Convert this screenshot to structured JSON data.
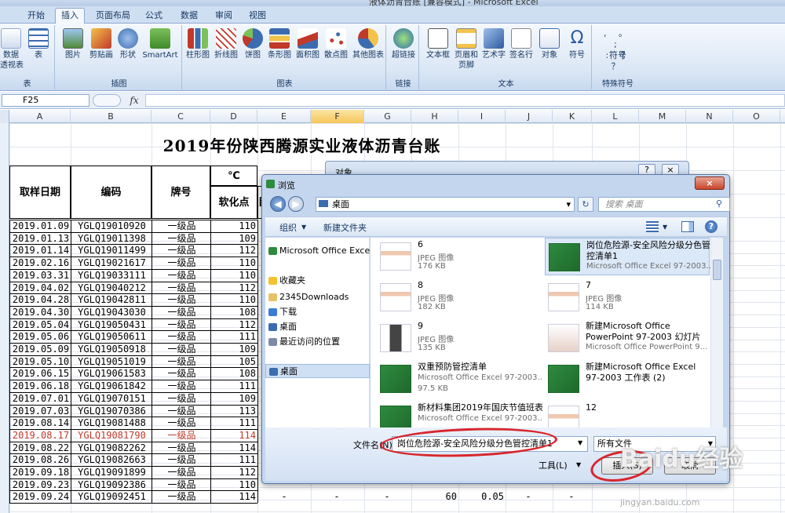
{
  "app": {
    "window_title": "液体沥青台账 [兼容模式] - Microsoft Excel"
  },
  "tabs": [
    {
      "label": "开始"
    },
    {
      "label": "插入"
    },
    {
      "label": "页面布局"
    },
    {
      "label": "公式"
    },
    {
      "label": "数据"
    },
    {
      "label": "审阅"
    },
    {
      "label": "视图"
    }
  ],
  "ribbon": {
    "groups": {
      "table": "表",
      "illustrations": "插图",
      "charts": "图表",
      "links": "链接",
      "text": "文本",
      "symbols": "特殊符号"
    },
    "buttons": {
      "pivot": "数据\n透视表",
      "table": "表",
      "picture": "图片",
      "clipart": "剪贴画",
      "shape": "形状",
      "smartart": "SmartArt",
      "column": "柱形图",
      "line": "折线图",
      "pie": "饼图",
      "bar": "条形图",
      "area": "面积图",
      "scatter": "散点图",
      "other_chart": "其他图表",
      "hyperlink": "超链接",
      "textbox": "文本框",
      "header_footer": "页眉和\n页脚",
      "wordart": "艺术字",
      "signature": "签名行",
      "object": "对象",
      "symbol": "符号",
      "special_symbol": "符号"
    }
  },
  "formula_bar": {
    "name_box": "F25",
    "fx": "fx",
    "value": ""
  },
  "columns": [
    "A",
    "B",
    "C",
    "D",
    "E",
    "F",
    "G",
    "H",
    "I",
    "J",
    "K",
    "L",
    "M",
    "N",
    "O"
  ],
  "sheet": {
    "title": "2019年份陕西腾源实业液体沥青台账",
    "headers": {
      "date": "取样日期",
      "code": "编码",
      "grade": "牌号",
      "unit": "℃",
      "softening": "软化点",
      "partial": "目"
    },
    "rows": [
      {
        "date": "2019.01.09",
        "code": "YGLQ19010920",
        "grade": "一级品",
        "sp": "110"
      },
      {
        "date": "2019.01.13",
        "code": "YGLQ19011398",
        "grade": "一级品",
        "sp": "109"
      },
      {
        "date": "2019.01.14",
        "code": "YGLQ19011499",
        "grade": "一级品",
        "sp": "112"
      },
      {
        "date": "2019.02.16",
        "code": "YGLQ19021617",
        "grade": "一级品",
        "sp": "110"
      },
      {
        "date": "2019.03.31",
        "code": "YGLQ19033111",
        "grade": "一级品",
        "sp": "110"
      },
      {
        "date": "2019.04.02",
        "code": "YGLQ19040212",
        "grade": "一级品",
        "sp": "112"
      },
      {
        "date": "2019.04.28",
        "code": "YGLQ19042811",
        "grade": "一级品",
        "sp": "110"
      },
      {
        "date": "2019.04.30",
        "code": "YGLQ19043030",
        "grade": "一级品",
        "sp": "108"
      },
      {
        "date": "2019.05.04",
        "code": "YGLQ19050431",
        "grade": "一级品",
        "sp": "112"
      },
      {
        "date": "2019.05.06",
        "code": "YGLQ19050611",
        "grade": "一级品",
        "sp": "111"
      },
      {
        "date": "2019.05.09",
        "code": "YGLQ19050918",
        "grade": "一级品",
        "sp": "109"
      },
      {
        "date": "2019.05.10",
        "code": "YGLQ19051019",
        "grade": "一级品",
        "sp": "105"
      },
      {
        "date": "2019.06.15",
        "code": "YGLQ19061583",
        "grade": "一级品",
        "sp": "108"
      },
      {
        "date": "2019.06.18",
        "code": "YGLQ19061842",
        "grade": "一级品",
        "sp": "111"
      },
      {
        "date": "2019.07.01",
        "code": "YGLQ19070151",
        "grade": "一级品",
        "sp": "109"
      },
      {
        "date": "2019.07.03",
        "code": "YGLQ19070386",
        "grade": "一级品",
        "sp": "113"
      },
      {
        "date": "2019.08.14",
        "code": "YGLQ19081488",
        "grade": "一级品",
        "sp": "111"
      },
      {
        "date": "2019.08.17",
        "code": "YGLQ19081790",
        "grade": "一级品",
        "sp": "114",
        "red": true
      },
      {
        "date": "2019.08.22",
        "code": "YGLQ19082262",
        "grade": "一级品",
        "sp": "114"
      },
      {
        "date": "2019.08.26",
        "code": "YGLQ19082663",
        "grade": "一级品",
        "sp": "111"
      },
      {
        "date": "2019.09.18",
        "code": "YGLQ19091899",
        "grade": "一级品",
        "sp": "112"
      },
      {
        "date": "2019.09.23",
        "code": "YGLQ19092386",
        "grade": "一级品",
        "sp": "110"
      },
      {
        "date": "2019.09.24",
        "code": "YGLQ19092451",
        "grade": "一级品",
        "sp": "114"
      }
    ],
    "last_row_extra": {
      "e": "-",
      "f": "-",
      "g": "-",
      "h": "60",
      "i": "0.05",
      "j": "-",
      "k": "-"
    }
  },
  "object_dialog": {
    "title": "对象",
    "help": "?",
    "close": "×"
  },
  "browse_dialog": {
    "title": "浏览",
    "close": "×",
    "address": "桌面",
    "refresh": "↻",
    "search_placeholder": "搜索 桌面",
    "toolbar": {
      "organize": "组织",
      "new_folder": "新建文件夹"
    },
    "nav": [
      {
        "label": "Microsoft Office Excel",
        "color": "#2e8a3e"
      },
      {
        "label": "收藏夹",
        "color": "#f2c230"
      },
      {
        "label": "2345Downloads",
        "color": "#e8c166"
      },
      {
        "label": "下载",
        "color": "#3a7bd5"
      },
      {
        "label": "桌面",
        "color": "#3c6cb0"
      },
      {
        "label": "最近访问的位置",
        "color": "#7b8ca8"
      },
      {
        "label": "桌面",
        "color": "#3c6cb0",
        "selected": true
      }
    ],
    "files": [
      {
        "name": "6",
        "type": "JPEG 图像",
        "size": "176 KB",
        "kind": "jpg"
      },
      {
        "name": "岗位危险源-安全风险分级分色管控清单1",
        "type": "Microsoft Office Excel 97-2003...",
        "size": "",
        "kind": "xls",
        "selected": true
      },
      {
        "name": "8",
        "type": "JPEG 图像",
        "size": "182 KB",
        "kind": "jpg"
      },
      {
        "name": "7",
        "type": "JPEG 图像",
        "size": "114 KB",
        "kind": "jpg"
      },
      {
        "name": "9",
        "type": "JPEG 图像",
        "size": "135 KB",
        "kind": "jpgdark"
      },
      {
        "name": "新建Microsoft Office PowerPoint 97-2003 幻灯片",
        "type": "Microsoft Office PowerPoint 9...",
        "size": "",
        "kind": "ppt"
      },
      {
        "name": "双重预防管控清单",
        "type": "Microsoft Office Excel 97-2003...",
        "size": "97.5 KB",
        "kind": "xls"
      },
      {
        "name": "新建Microsoft Office Excel 97-2003 工作表 (2)",
        "type": "",
        "size": "",
        "kind": "xls"
      },
      {
        "name": "新材料集团2019年国庆节值班表",
        "type": "Microsoft Office Excel 97-2003...",
        "size": "",
        "kind": "xls"
      },
      {
        "name": "12",
        "type": "",
        "size": "",
        "kind": "jpg"
      }
    ],
    "filename_label": "文件名(N):",
    "filename_value": "岗位危险源-安全风险分级分色管控清单1",
    "filetype_value": "所有文件",
    "tools": "工具(L)",
    "insert": "插入(S)",
    "cancel": "取消"
  },
  "watermark": {
    "text": "Baidu经验",
    "url": "jingyan.baidu.com"
  },
  "colors": {
    "annotation_red": "#d9252c",
    "excel_green": "#2e8a3e"
  }
}
